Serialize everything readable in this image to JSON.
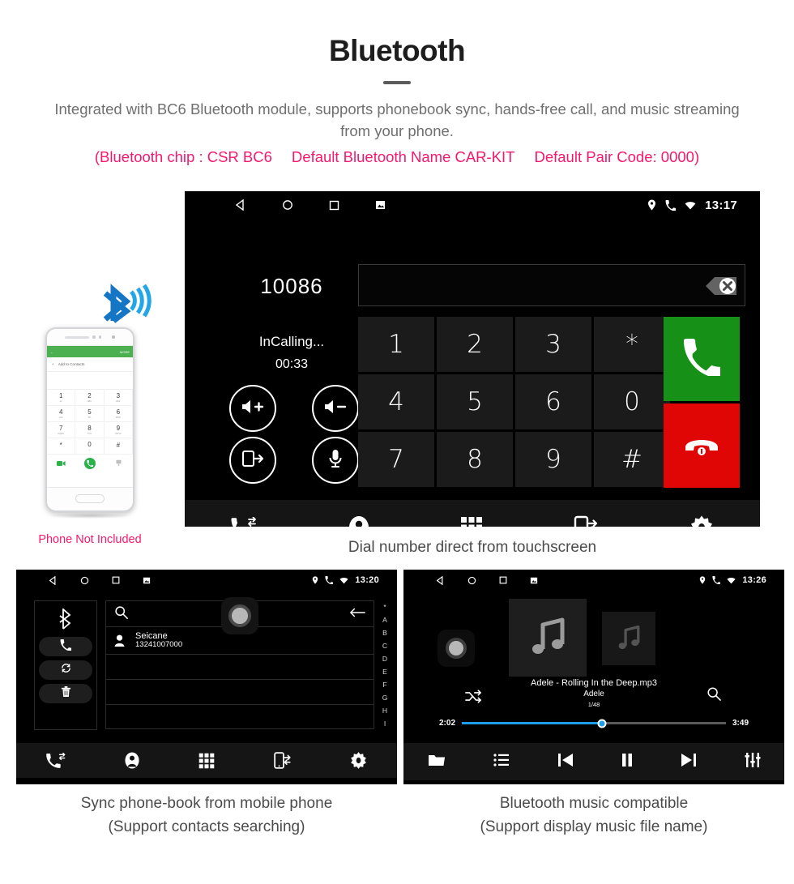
{
  "header": {
    "title": "Bluetooth",
    "subtitle": "Integrated with BC6 Bluetooth module, supports phonebook sync, hands-free call, and music streaming from your phone.",
    "specs": [
      "(Bluetooth chip : CSR BC6",
      "Default Bluetooth Name CAR-KIT",
      "Default Pair Code: 0000)"
    ],
    "accent_color": "#f6186e",
    "text_color": "#6f6f6f"
  },
  "dialer": {
    "status_bar": {
      "time": "13:17",
      "left_icons": [
        "back-icon",
        "home-icon",
        "recents-icon",
        "screenshot-icon"
      ],
      "right_icons": [
        "location-icon",
        "phone-icon",
        "wifi-icon"
      ]
    },
    "number": "10086",
    "input_value": "",
    "call_state": "InCalling...",
    "call_timer": "00:33",
    "control_buttons": [
      {
        "name": "volume-up-button",
        "icon": "speaker-plus-icon"
      },
      {
        "name": "volume-down-button",
        "icon": "speaker-minus-icon"
      },
      {
        "name": "transfer-to-phone-button",
        "icon": "phone-transfer-icon"
      },
      {
        "name": "mute-button",
        "icon": "microphone-icon"
      }
    ],
    "keypad": [
      "1",
      "2",
      "3",
      "*",
      "4",
      "5",
      "6",
      "0",
      "7",
      "8",
      "9",
      "#"
    ],
    "call_button": {
      "label": "call-icon",
      "color": "#169016"
    },
    "hangup_button": {
      "label": "hangup-icon",
      "color": "#e00606"
    },
    "nav_items": [
      "call-history-icon",
      "contacts-icon",
      "keypad-icon",
      "phone-sync-icon",
      "settings-icon"
    ],
    "caption": "Dial number direct from touchscreen"
  },
  "phone_mock": {
    "appbar_more": "MORE",
    "add_to_contacts": "Add to Contacts",
    "keys": [
      {
        "d": "1",
        "s": "oo"
      },
      {
        "d": "2",
        "s": "ABC"
      },
      {
        "d": "3",
        "s": "DEF"
      },
      {
        "d": "4",
        "s": "GHI"
      },
      {
        "d": "5",
        "s": "JKL"
      },
      {
        "d": "6",
        "s": "MNO"
      },
      {
        "d": "7",
        "s": "PQRS"
      },
      {
        "d": "8",
        "s": "TUV"
      },
      {
        "d": "9",
        "s": "WXYZ"
      },
      {
        "d": "*",
        "s": ""
      },
      {
        "d": "0",
        "s": "+"
      },
      {
        "d": "#",
        "s": ""
      }
    ],
    "note": "Phone Not Included",
    "note_color": "#f6186e",
    "bluetooth_color": "#1c9ad6"
  },
  "phonebook": {
    "status_bar": {
      "time": "13:20"
    },
    "sidebar": [
      {
        "name": "bluetooth-status-icon",
        "icon": "bluetooth-icon"
      },
      {
        "name": "dial-button",
        "icon": "phone-icon"
      },
      {
        "name": "sync-contacts-button",
        "icon": "sync-icon"
      },
      {
        "name": "delete-contacts-button",
        "icon": "trash-icon"
      }
    ],
    "search_placeholder": "",
    "contacts": [
      {
        "name": "Seicane",
        "number": "13241007000"
      }
    ],
    "alphabet_index": [
      "*",
      "A",
      "B",
      "C",
      "D",
      "E",
      "F",
      "G",
      "H",
      "I"
    ],
    "nav_items": [
      "call-history-icon",
      "contacts-icon",
      "keypad-icon",
      "phone-sync-icon",
      "settings-icon"
    ],
    "caption_line1": "Sync phone-book from mobile phone",
    "caption_line2": "(Support contacts searching)"
  },
  "music": {
    "status_bar": {
      "time": "13:26"
    },
    "track_title": "Adele - Rolling In the Deep.mp3",
    "artist": "Adele",
    "track_index": "1/48",
    "elapsed": "2:02",
    "duration": "3:49",
    "progress_percent": 53,
    "progress_color": "#1e9ee8",
    "controls": [
      "folder-icon",
      "playlist-icon",
      "previous-icon",
      "pause-icon",
      "next-icon",
      "equalizer-icon"
    ],
    "caption_line1": "Bluetooth music compatible",
    "caption_line2": "(Support display music file name)"
  }
}
